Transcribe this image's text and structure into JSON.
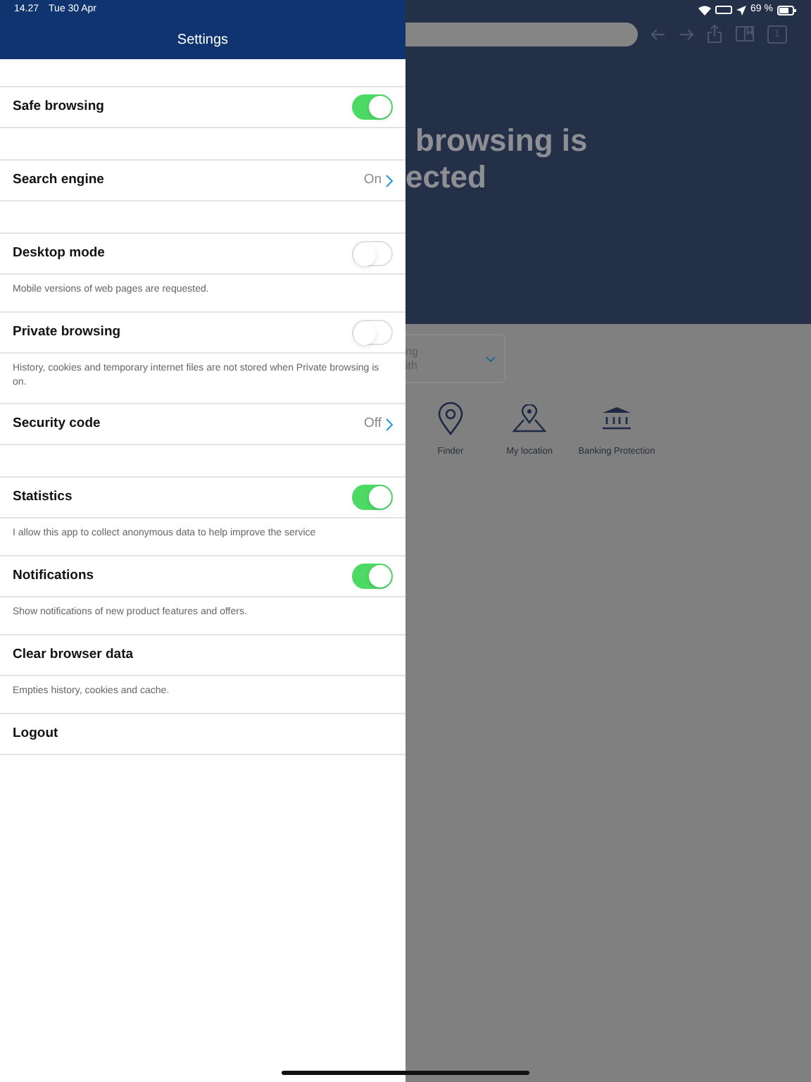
{
  "status_bar": {
    "time": "14.27",
    "date": "Tue 30 Apr",
    "battery": "69 %"
  },
  "settings": {
    "title": "Settings",
    "items": [
      {
        "kind": "toggle",
        "label": "Safe browsing",
        "on": true
      },
      {
        "kind": "link",
        "label": "Search engine",
        "value": "On"
      },
      {
        "kind": "toggle",
        "label": "Desktop mode",
        "on": false,
        "description": "Mobile versions of web pages are requested."
      },
      {
        "kind": "toggle",
        "label": "Private browsing",
        "on": false,
        "description": "History, cookies and temporary internet files are not stored when Private browsing is on."
      },
      {
        "kind": "link",
        "label": "Security code",
        "value": "Off"
      },
      {
        "kind": "toggle",
        "label": "Statistics",
        "on": true,
        "description": "I allow this app to collect anonymous data to help improve the service"
      },
      {
        "kind": "toggle",
        "label": "Notifications",
        "on": true,
        "description": "Show notifications of new product features and offers."
      },
      {
        "kind": "action",
        "label": "Clear browser data",
        "description": "Empties history, cookies and cache."
      },
      {
        "kind": "action",
        "label": "Logout"
      }
    ]
  },
  "browser": {
    "tab_count": "1",
    "headline": [
      "browsing is",
      "ected"
    ],
    "dropdown": [
      "ng",
      "ith"
    ],
    "shortcuts": [
      {
        "kind": "finder",
        "label": "Finder"
      },
      {
        "kind": "location",
        "label": "My location"
      },
      {
        "kind": "bank",
        "label": "Banking Protection"
      }
    ]
  }
}
